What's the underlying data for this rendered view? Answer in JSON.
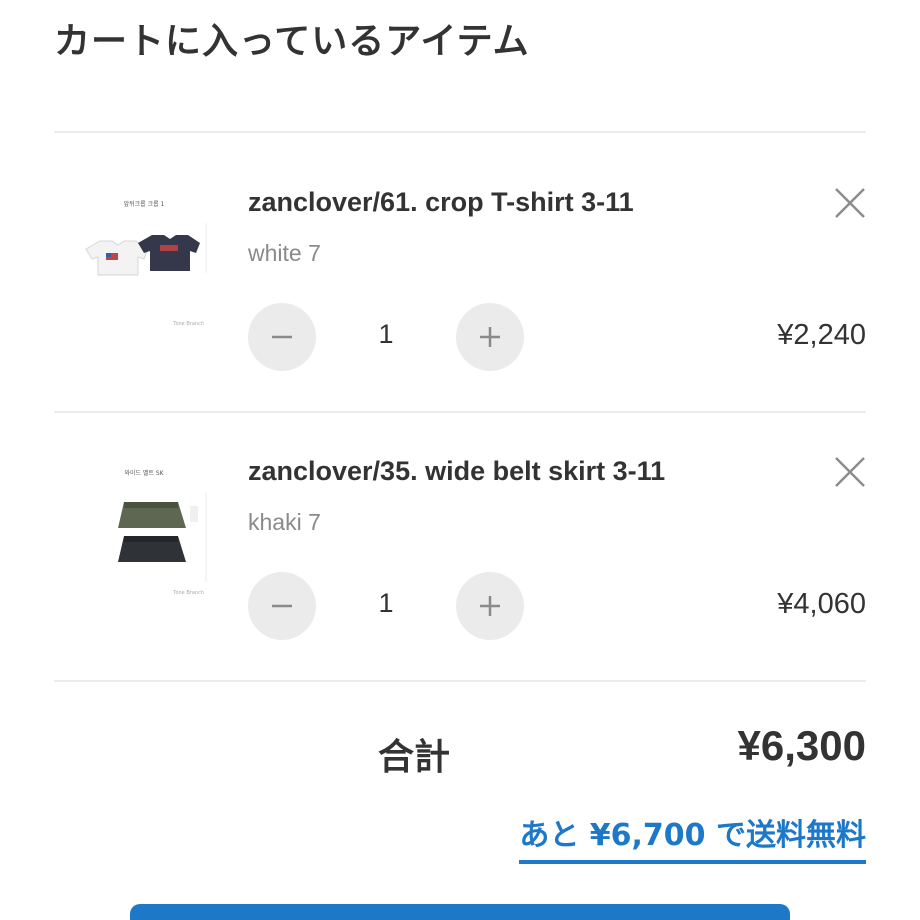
{
  "page": {
    "title": "カートに入っているアイテム"
  },
  "cart": {
    "items": [
      {
        "name": "zanclover/61. crop T-shirt 3-11",
        "variant": "white 7",
        "quantity": "1",
        "price": "¥2,240",
        "thumbnail_caption": "앞뒤크롭 크롭 1",
        "thumbnail_footer": "Tone Branch"
      },
      {
        "name": "zanclover/35. wide belt skirt 3-11",
        "variant": "khaki 7",
        "quantity": "1",
        "price": "¥4,060",
        "thumbnail_caption": "와이드 벨트 SK",
        "thumbnail_footer": "Tone Branch"
      }
    ]
  },
  "summary": {
    "total_label": "合計",
    "total_value": "¥6,300",
    "free_shipping_text": "あと ¥6,700 で送料無料"
  },
  "colors": {
    "accent": "#1e78c8",
    "text": "#333333",
    "muted": "#8a8a8a",
    "button_bg": "#ebebeb",
    "divider": "#ececec"
  },
  "icons": {
    "remove": "close-icon",
    "decrease": "minus-icon",
    "increase": "plus-icon"
  }
}
